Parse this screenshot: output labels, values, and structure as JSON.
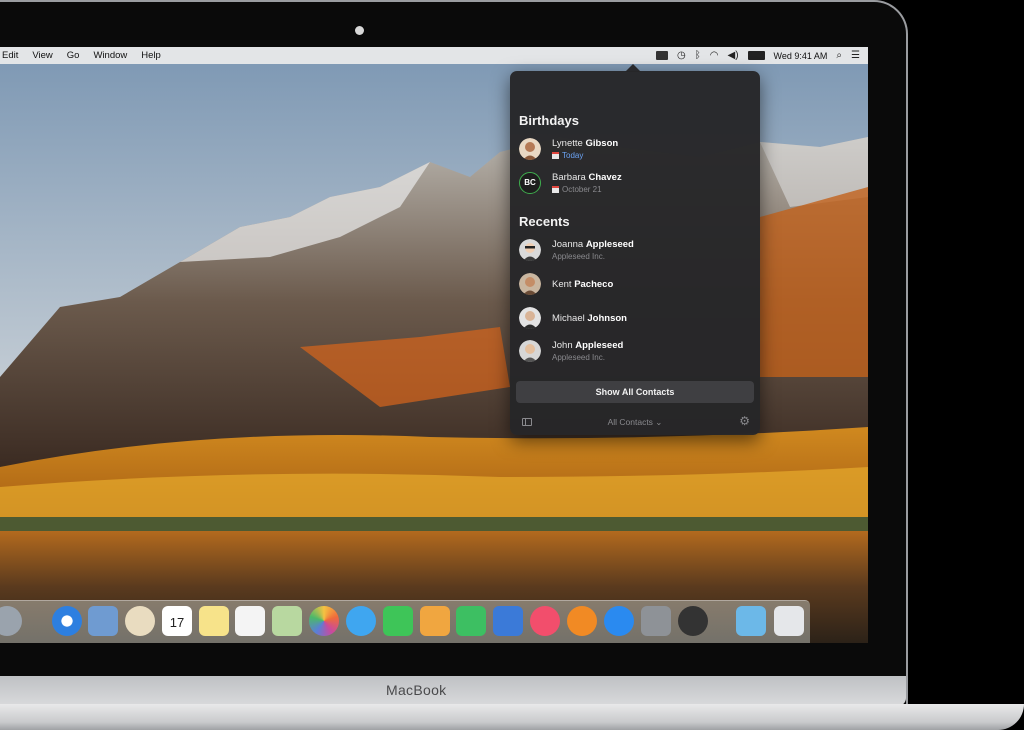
{
  "menubar": {
    "items": [
      "Edit",
      "View",
      "Go",
      "Window",
      "Help"
    ],
    "clock": "Wed 9:41 AM"
  },
  "contacts_popover": {
    "birthdays_title": "Birthdays",
    "birthdays": [
      {
        "first": "Lynette",
        "last": "Gibson",
        "date": "Today",
        "avatar": "photo"
      },
      {
        "first": "Barbara",
        "last": "Chavez",
        "date": "October 21",
        "avatar": "initials",
        "initials": "BC"
      }
    ],
    "recents_title": "Recents",
    "recents": [
      {
        "first": "Joanna",
        "last": "Appleseed",
        "company": "Appleseed Inc."
      },
      {
        "first": "Kent",
        "last": "Pacheco",
        "company": ""
      },
      {
        "first": "Michael",
        "last": "Johnson",
        "company": ""
      },
      {
        "first": "John",
        "last": "Appleseed",
        "company": "Appleseed Inc."
      }
    ],
    "show_all_label": "Show All Contacts",
    "group_selector": "All Contacts ⌄"
  },
  "dock": {
    "icons": [
      "launchpad-icon",
      "safari-icon",
      "mail-icon",
      "contacts-icon",
      "calendar-icon",
      "notes-icon",
      "reminders-icon",
      "maps-icon",
      "photos-icon",
      "messages-icon",
      "facetime-icon",
      "pages-icon",
      "numbers-icon",
      "keynote-icon",
      "music-icon",
      "books-icon",
      "app-store-icon",
      "system-preferences-icon",
      "activity-monitor-icon",
      "downloads-folder-icon",
      "trash-icon"
    ],
    "calendar_day": "17",
    "calendar_month": "JUL"
  },
  "laptop": {
    "brand": "MacBook"
  }
}
